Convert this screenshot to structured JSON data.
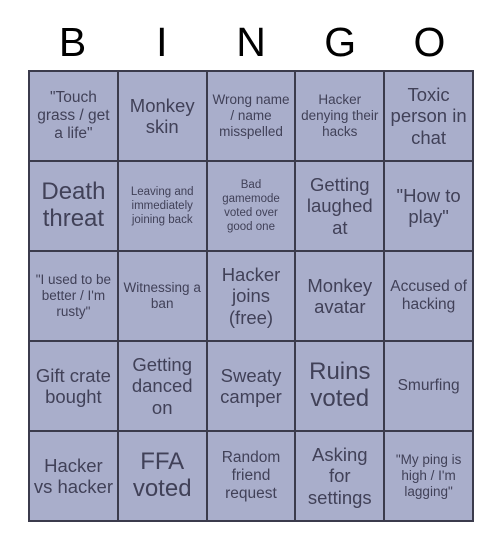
{
  "card": {
    "title": "BINGO",
    "header_letters": [
      "B",
      "I",
      "N",
      "G",
      "O"
    ],
    "colors": {
      "cell_fill": "#a9aecb",
      "cell_text": "#414158",
      "grid_border": "#3b3b4c",
      "header_text": "#000000",
      "page_background": "#ffffff"
    },
    "grid": {
      "columns": 5,
      "rows": 5
    },
    "cells": [
      {
        "text": "\"Touch grass / get a life\"",
        "size": "m"
      },
      {
        "text": "Monkey skin",
        "size": "l"
      },
      {
        "text": "Wrong name / name misspelled",
        "size": "s"
      },
      {
        "text": "Hacker denying their hacks",
        "size": "s"
      },
      {
        "text": "Toxic person in chat",
        "size": "l"
      },
      {
        "text": "Death threat",
        "size": "xl"
      },
      {
        "text": "Leaving and immediately joining back",
        "size": "xs"
      },
      {
        "text": "Bad gamemode voted over good one",
        "size": "xs"
      },
      {
        "text": "Getting laughed at",
        "size": "l"
      },
      {
        "text": "\"How to play\"",
        "size": "l"
      },
      {
        "text": "\"I used to be better / I'm rusty\"",
        "size": "s"
      },
      {
        "text": "Witnessing a ban",
        "size": "s"
      },
      {
        "text": "Hacker joins (free)",
        "size": "l"
      },
      {
        "text": "Monkey avatar",
        "size": "l"
      },
      {
        "text": "Accused of hacking",
        "size": "m"
      },
      {
        "text": "Gift crate bought",
        "size": "l"
      },
      {
        "text": "Getting danced on",
        "size": "l"
      },
      {
        "text": "Sweaty camper",
        "size": "l"
      },
      {
        "text": "Ruins voted",
        "size": "xl"
      },
      {
        "text": "Smurfing",
        "size": "m"
      },
      {
        "text": "Hacker vs hacker",
        "size": "l"
      },
      {
        "text": "FFA voted",
        "size": "xl"
      },
      {
        "text": "Random friend request",
        "size": "m"
      },
      {
        "text": "Asking for settings",
        "size": "l"
      },
      {
        "text": "\"My ping is high / I'm lagging\"",
        "size": "s"
      }
    ]
  }
}
